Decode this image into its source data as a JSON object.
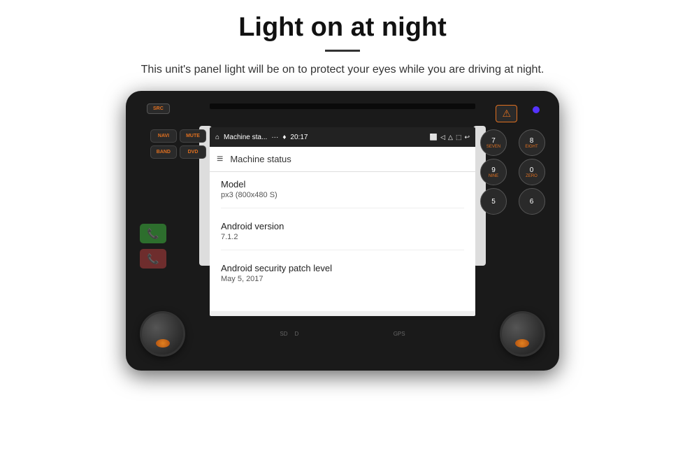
{
  "header": {
    "title": "Light on at night",
    "divider": true,
    "subtitle": "This unit's panel light will be on to protect your eyes while you are driving at night."
  },
  "device": {
    "screen": {
      "statusbar": {
        "home": "⌂",
        "app_name": "Machine sta...",
        "dots": "···",
        "pin_icon": "📍",
        "time": "20:17",
        "camera_icon": "📷",
        "volume_icon": "◁",
        "eject_icon": "⏏",
        "monitor_icon": "🖥",
        "back_icon": "↩"
      },
      "appbar": {
        "menu_icon": "≡",
        "title": "Machine status"
      },
      "info_rows": [
        {
          "label": "Model",
          "value": "px3 (800x480 S)"
        },
        {
          "label": "Android version",
          "value": "7.1.2"
        },
        {
          "label": "Android security patch level",
          "value": "May 5, 2017"
        }
      ]
    },
    "buttons": {
      "left_top": [
        "SRC"
      ],
      "left_side": [
        [
          "NAVI",
          "MUTE"
        ],
        [
          "BAND",
          "DVD"
        ]
      ],
      "right_side": [
        {
          "num": "7",
          "label": "SEVEN"
        },
        {
          "num": "8",
          "label": "EIGHT"
        },
        {
          "num": "9",
          "label": "NINE"
        },
        {
          "num": "0",
          "label": "ZERO"
        },
        {
          "num": "5",
          "label": ""
        },
        {
          "num": "6",
          "label": ""
        }
      ]
    },
    "sd_labels": [
      "SD",
      "D"
    ],
    "gps_label": "GPS"
  }
}
